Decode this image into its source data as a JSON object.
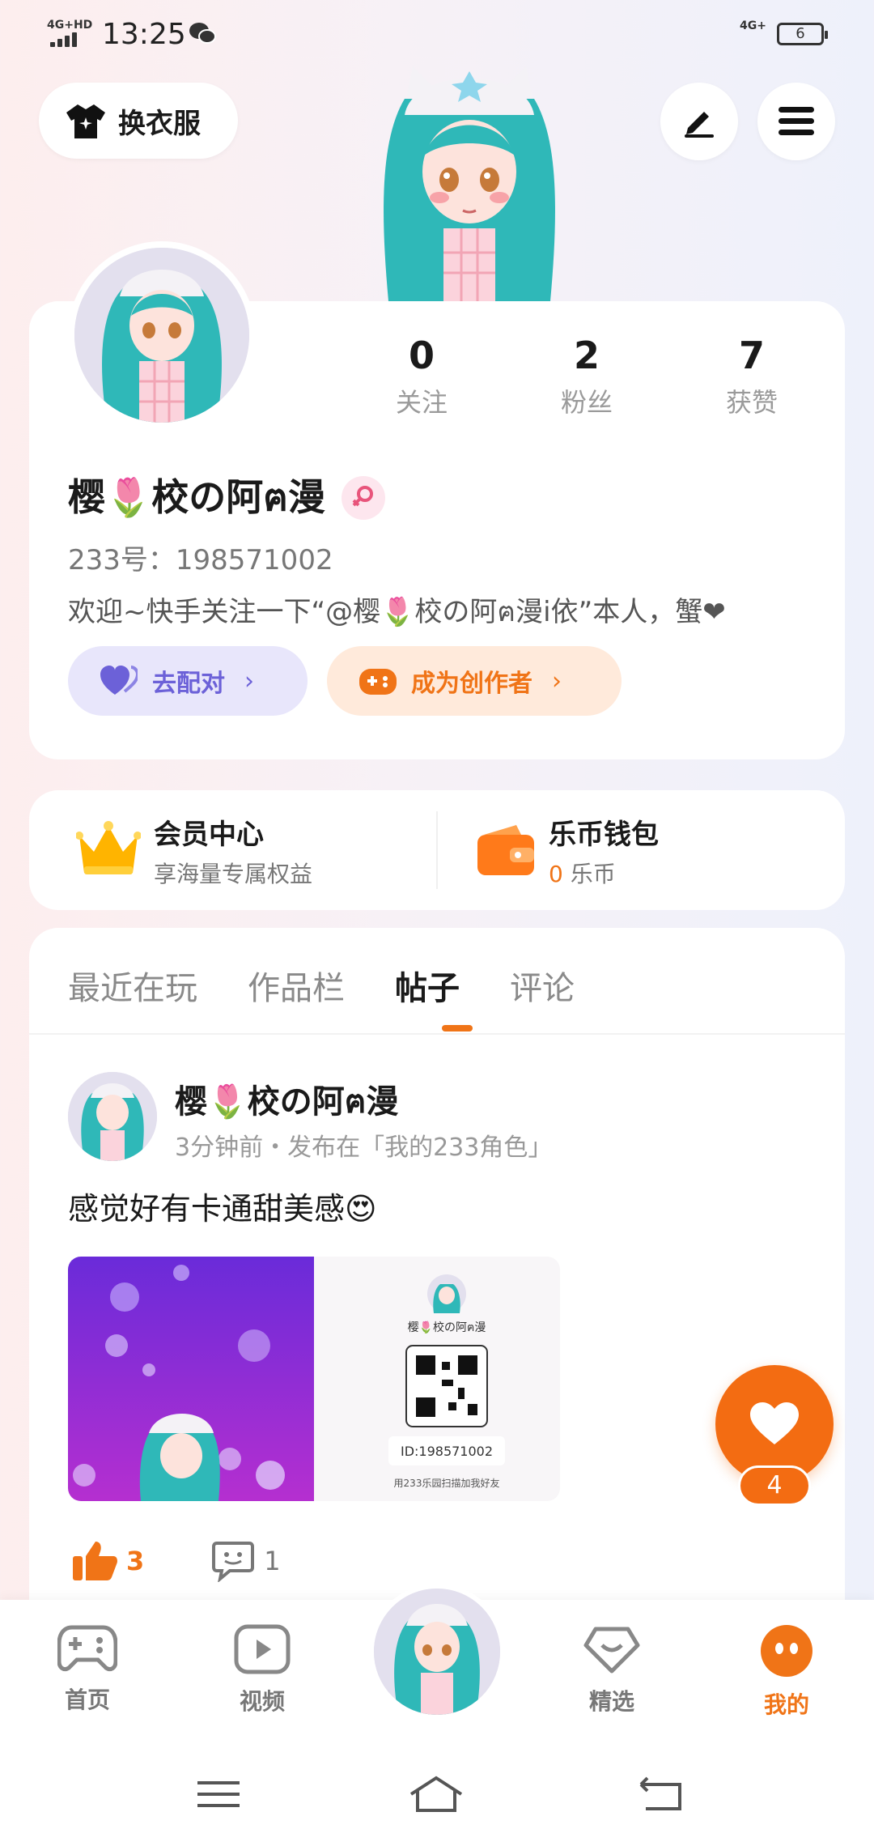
{
  "status_bar": {
    "network": "4G+HD",
    "time": "13:25",
    "network_right": "4G+",
    "battery": "6"
  },
  "top": {
    "dress_label": "换衣服"
  },
  "profile": {
    "stats": [
      {
        "value": "0",
        "label": "关注"
      },
      {
        "value": "2",
        "label": "粉丝"
      },
      {
        "value": "7",
        "label": "获赞"
      }
    ],
    "name": "樱🌷校の阿ฅ漫",
    "uid": "233号：198571002",
    "bio": "欢迎~快手关注一下“@樱🌷校の阿ฅ漫i依”本人，蟹❤",
    "match_label": "去配对",
    "creator_label": "成为创作者",
    "gender_color": "#e8547b"
  },
  "member": {
    "vip_title": "会员中心",
    "vip_sub": "享海量专属权益",
    "wallet_title": "乐币钱包",
    "wallet_amount": "0",
    "wallet_unit": "乐币"
  },
  "tabs": [
    {
      "label": "最近在玩"
    },
    {
      "label": "作品栏"
    },
    {
      "label": "帖子"
    },
    {
      "label": "评论"
    }
  ],
  "post": {
    "author": "樱🌷校の阿ฅ漫",
    "meta": "3分钟前・发布在「我的233角色」",
    "text": "感觉好有卡通甜美感😍",
    "card_name": "樱🌷校の阿ฅ漫",
    "card_id": "ID:198571002",
    "card_hint": "用233乐园扫描加我好友",
    "likes": "3",
    "comments": "1"
  },
  "fab": {
    "count": "4"
  },
  "nav": [
    {
      "label": "首页"
    },
    {
      "label": "视频"
    },
    {
      "label": "精选"
    },
    {
      "label": "我的"
    }
  ],
  "colors": {
    "accent": "#f07417",
    "purple": "#6c61d8",
    "teal_hair": "#2fb8b8"
  }
}
